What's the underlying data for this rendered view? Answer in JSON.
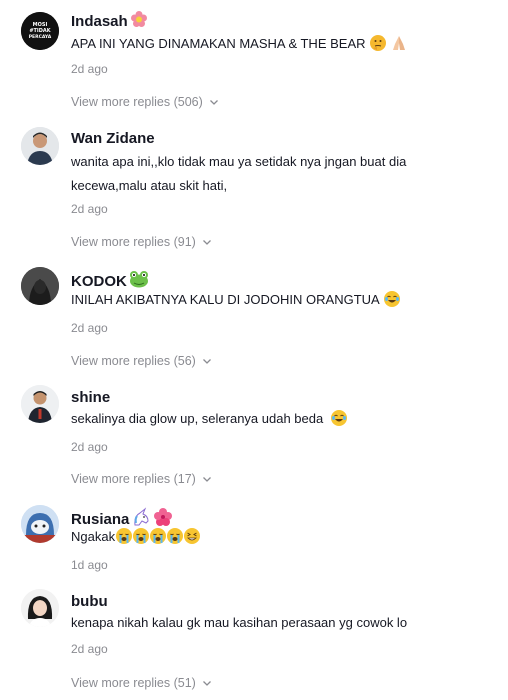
{
  "comments": [
    {
      "username": "Indasah",
      "username_emoji": "flower-icon",
      "text": "APA INI YANG DINAMAKAN MASHA & THE BEAR",
      "text_emojis": [
        "thinking-face-icon",
        "folded-hands-icon"
      ],
      "date": "2d ago",
      "replies": "View more replies (506)",
      "avatar_text": "MOSI TIDAK PERCAYA"
    },
    {
      "username": "Wan Zidane",
      "text_line1": "wanita apa ini,,klo tidak mau ya setidak nya jngan buat dia",
      "text_line2": "kecewa,malu atau skit hati,",
      "date": "2d ago",
      "replies": "View more replies (91)"
    },
    {
      "username": "KODOK",
      "username_emoji": "frog-icon",
      "text": "INILAH AKIBATNYA KALU DI JODOHIN ORANGTUA",
      "text_emojis": [
        "tears-of-joy-icon"
      ],
      "date": "2d ago",
      "replies": "View more replies (56)"
    },
    {
      "username": "shine",
      "text": "sekalinya dia glow up, seleranya udah beda",
      "text_emojis": [
        "tears-of-joy-icon"
      ],
      "date": "2d ago",
      "replies": "View more replies (17)"
    },
    {
      "username": "Rusiana",
      "username_emojis": [
        "unicorn-icon",
        "hibiscus-icon"
      ],
      "text": "Ngakak",
      "text_emojis": [
        "loudly-crying-icon",
        "loudly-crying-icon",
        "loudly-crying-icon",
        "loudly-crying-icon",
        "grinning-squint-icon"
      ],
      "date": "1d ago"
    },
    {
      "username": "bubu",
      "text": "kenapa nikah kalau gk mau kasihan perasaan yg cowok lo",
      "date": "2d ago",
      "replies": "View more replies (51)"
    }
  ]
}
